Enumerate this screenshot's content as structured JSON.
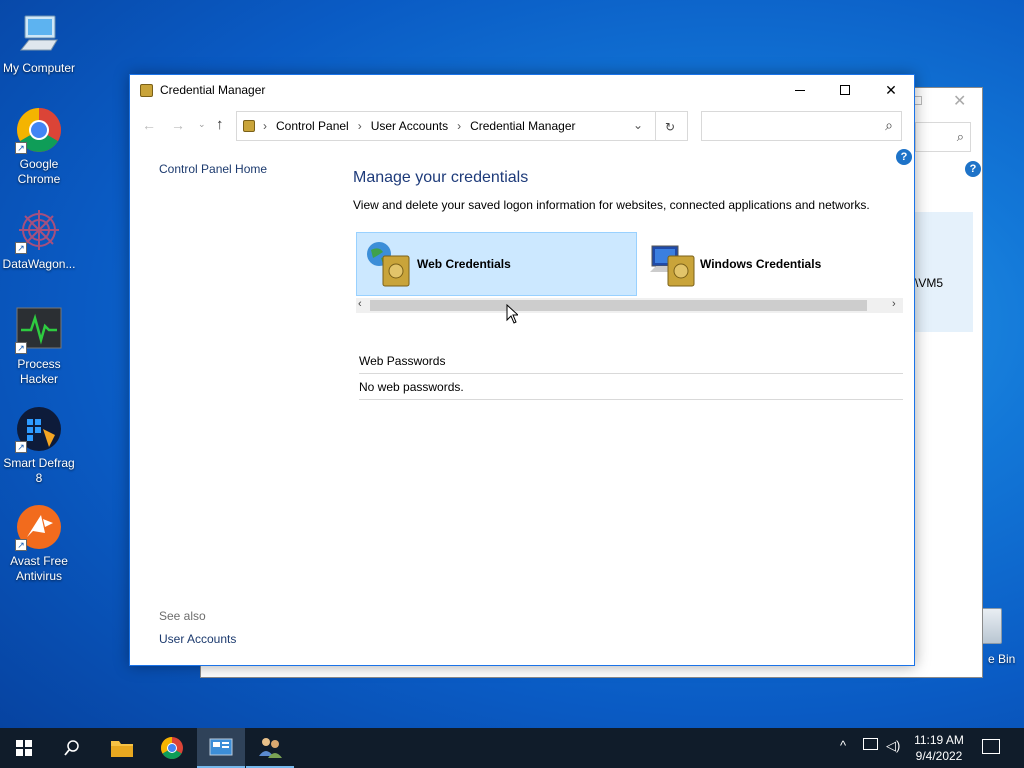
{
  "desktop": {
    "icons": [
      {
        "label": "My Computer"
      },
      {
        "label": "Google Chrome"
      },
      {
        "label": "DataWagon..."
      },
      {
        "label": "Process Hacker"
      },
      {
        "label": "Smart Defrag 8"
      },
      {
        "label": "Avast Free Antivirus"
      }
    ],
    "recycle_bin_label": "e Bin"
  },
  "background_window": {
    "fragment_text": "\\VM5"
  },
  "window": {
    "title": "Credential Manager",
    "breadcrumb": [
      "Control Panel",
      "User Accounts",
      "Credential Manager"
    ],
    "search_placeholder": "",
    "sidebar": {
      "home_link": "Control Panel Home",
      "see_also": "See also",
      "user_accounts_link": "User Accounts"
    },
    "main": {
      "heading": "Manage your credentials",
      "description": "View and delete your saved logon information for websites, connected applications and networks.",
      "tiles": [
        {
          "label": "Web Credentials",
          "selected": true
        },
        {
          "label": "Windows Credentials",
          "selected": false
        }
      ],
      "section_header": "Web Passwords",
      "section_empty": "No web passwords."
    },
    "help_glyph": "?"
  },
  "taskbar": {
    "time": "11:19 AM",
    "date": "9/4/2022"
  },
  "colors": {
    "accent": "#1a73e8",
    "heading": "#1e3b7a",
    "tile_selected": "#cce8ff",
    "taskbar": "#101c2a"
  }
}
